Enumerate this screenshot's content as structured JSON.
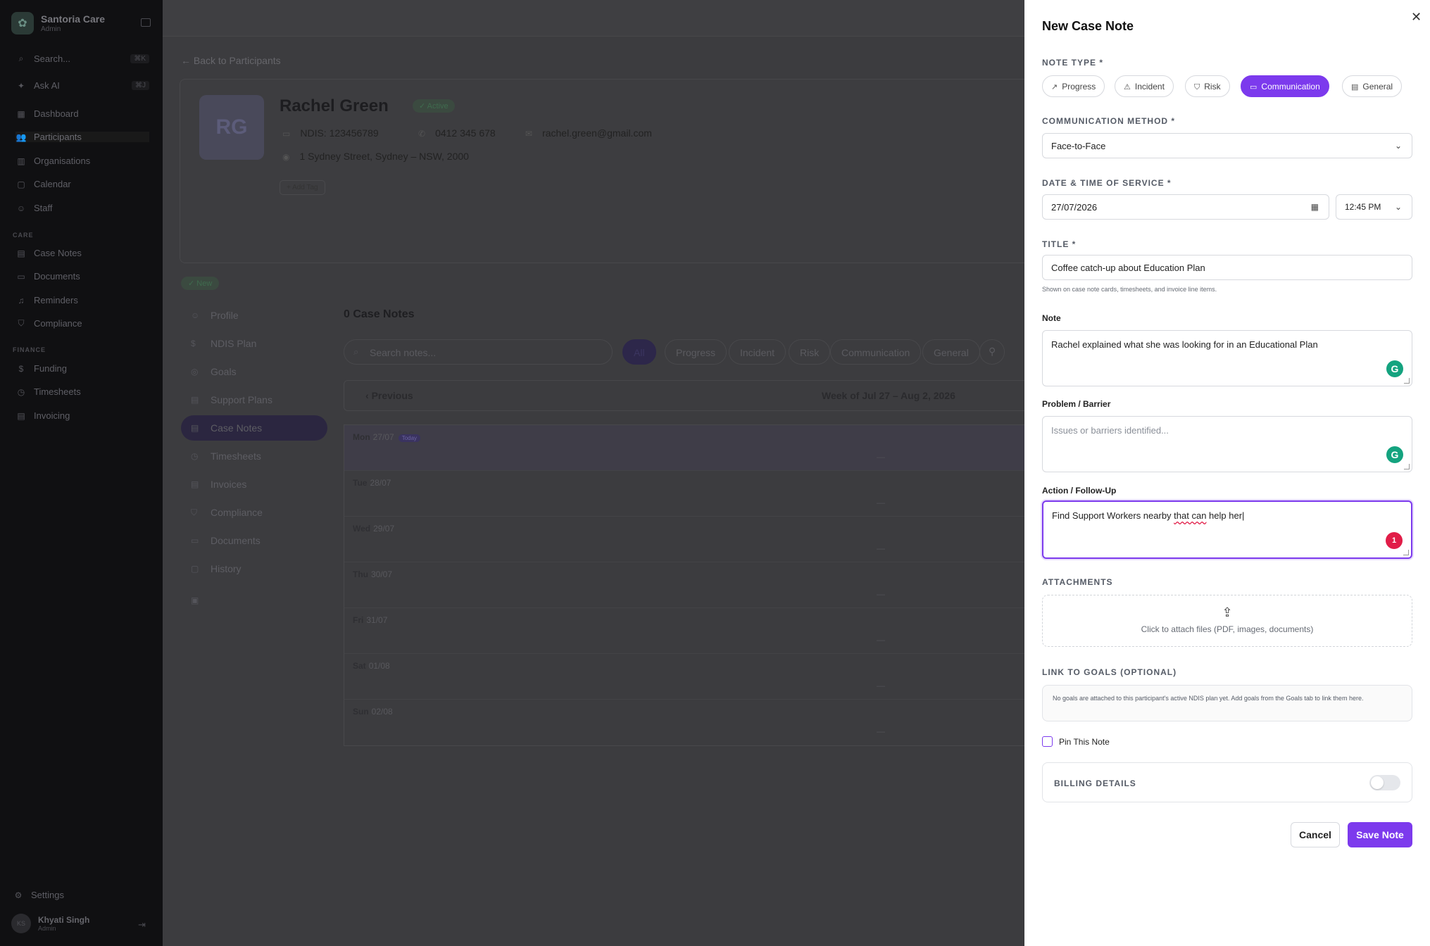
{
  "sidebar": {
    "brand_name": "Santoria Care",
    "brand_role": "Admin",
    "search_placeholder": "Search...",
    "search_shortcut": "⌘K",
    "ask_ai": "Ask AI",
    "ask_ai_shortcut": "⌘J",
    "nav": [
      "Dashboard",
      "Participants",
      "Organisations",
      "Calendar",
      "Staff"
    ],
    "care_title": "CARE",
    "care": [
      "Case Notes",
      "Documents",
      "Reminders",
      "Compliance"
    ],
    "finance_title": "FINANCE",
    "finance": [
      "Funding",
      "Timesheets",
      "Invoicing"
    ],
    "settings": "Settings",
    "user_name": "Khyati Singh",
    "user_role": "Admin",
    "user_initials": "KS"
  },
  "main": {
    "back_link": "Back to Participants",
    "participant": {
      "initials": "RG",
      "name": "Rachel Green",
      "status": "Active",
      "ndis": "NDIS: 123456789",
      "phone": "0412 345 678",
      "email": "rachel.green@gmail.com",
      "address": "1 Sydney Street, Sydney – NSW, 2000",
      "add_tag": "Add Tag",
      "new_badge": "New"
    },
    "tabs": [
      "Profile",
      "NDIS Plan",
      "Goals",
      "Support Plans",
      "Case Notes",
      "Timesheets",
      "Invoices",
      "Compliance",
      "Documents",
      "History"
    ],
    "case_notes_title": "0 Case Notes",
    "search_placeholder": "Search notes...",
    "filters": [
      "All",
      "Progress",
      "Incident",
      "Risk",
      "Communication",
      "General"
    ],
    "prev_label": "Previous",
    "week_label": "Week of Jul 27 – Aug 2, 2026",
    "today_tag": "Today",
    "days": [
      {
        "name": "Mon",
        "date": "27/07",
        "empty": "—"
      },
      {
        "name": "Tue",
        "date": "28/07",
        "empty": "—"
      },
      {
        "name": "Wed",
        "date": "29/07",
        "empty": "—"
      },
      {
        "name": "Thu",
        "date": "30/07",
        "empty": "—"
      },
      {
        "name": "Fri",
        "date": "31/07",
        "empty": "—"
      },
      {
        "name": "Sat",
        "date": "01/08",
        "empty": "—"
      },
      {
        "name": "Sun",
        "date": "02/08",
        "empty": "—"
      }
    ]
  },
  "drawer": {
    "title": "New Case Note",
    "note_type_label": "NOTE TYPE *",
    "note_types": [
      "Progress",
      "Incident",
      "Risk",
      "Communication",
      "General"
    ],
    "selected_type": "Communication",
    "comm_method_label": "COMMUNICATION METHOD *",
    "comm_method_value": "Face-to-Face",
    "datetime_label": "DATE & TIME OF SERVICE *",
    "date_value": "27/07/2026",
    "time_value": "12:45 PM",
    "title_label": "TITLE *",
    "title_value": "Coffee catch-up about Education Plan",
    "title_helper": "Shown on case note cards, timesheets, and invoice line items.",
    "note_label": "Note",
    "note_value": "Rachel explained what she was looking for in an Educational Plan",
    "problem_label": "Problem / Barrier",
    "problem_placeholder": "Issues or barriers identified...",
    "action_label": "Action / Follow-Up",
    "action_value_a": "Find Support Workers nearby ",
    "action_value_b": "that can",
    "action_value_c": " help her",
    "grammar_alert_count": "1",
    "attachments_label": "ATTACHMENTS",
    "attachments_text": "Click to attach files (PDF, images, documents)",
    "goals_label": "LINK TO GOALS (OPTIONAL)",
    "goals_text": "No goals are attached to this participant's active NDIS plan yet. Add goals from the Goals tab to link them here.",
    "pin_label": "Pin This Note",
    "billing_label": "BILLING DETAILS",
    "cancel_label": "Cancel",
    "save_label": "Save Note"
  },
  "colors": {
    "accent": "#7c3aed",
    "grammarly": "#14a37f",
    "alert": "#e11d48"
  }
}
